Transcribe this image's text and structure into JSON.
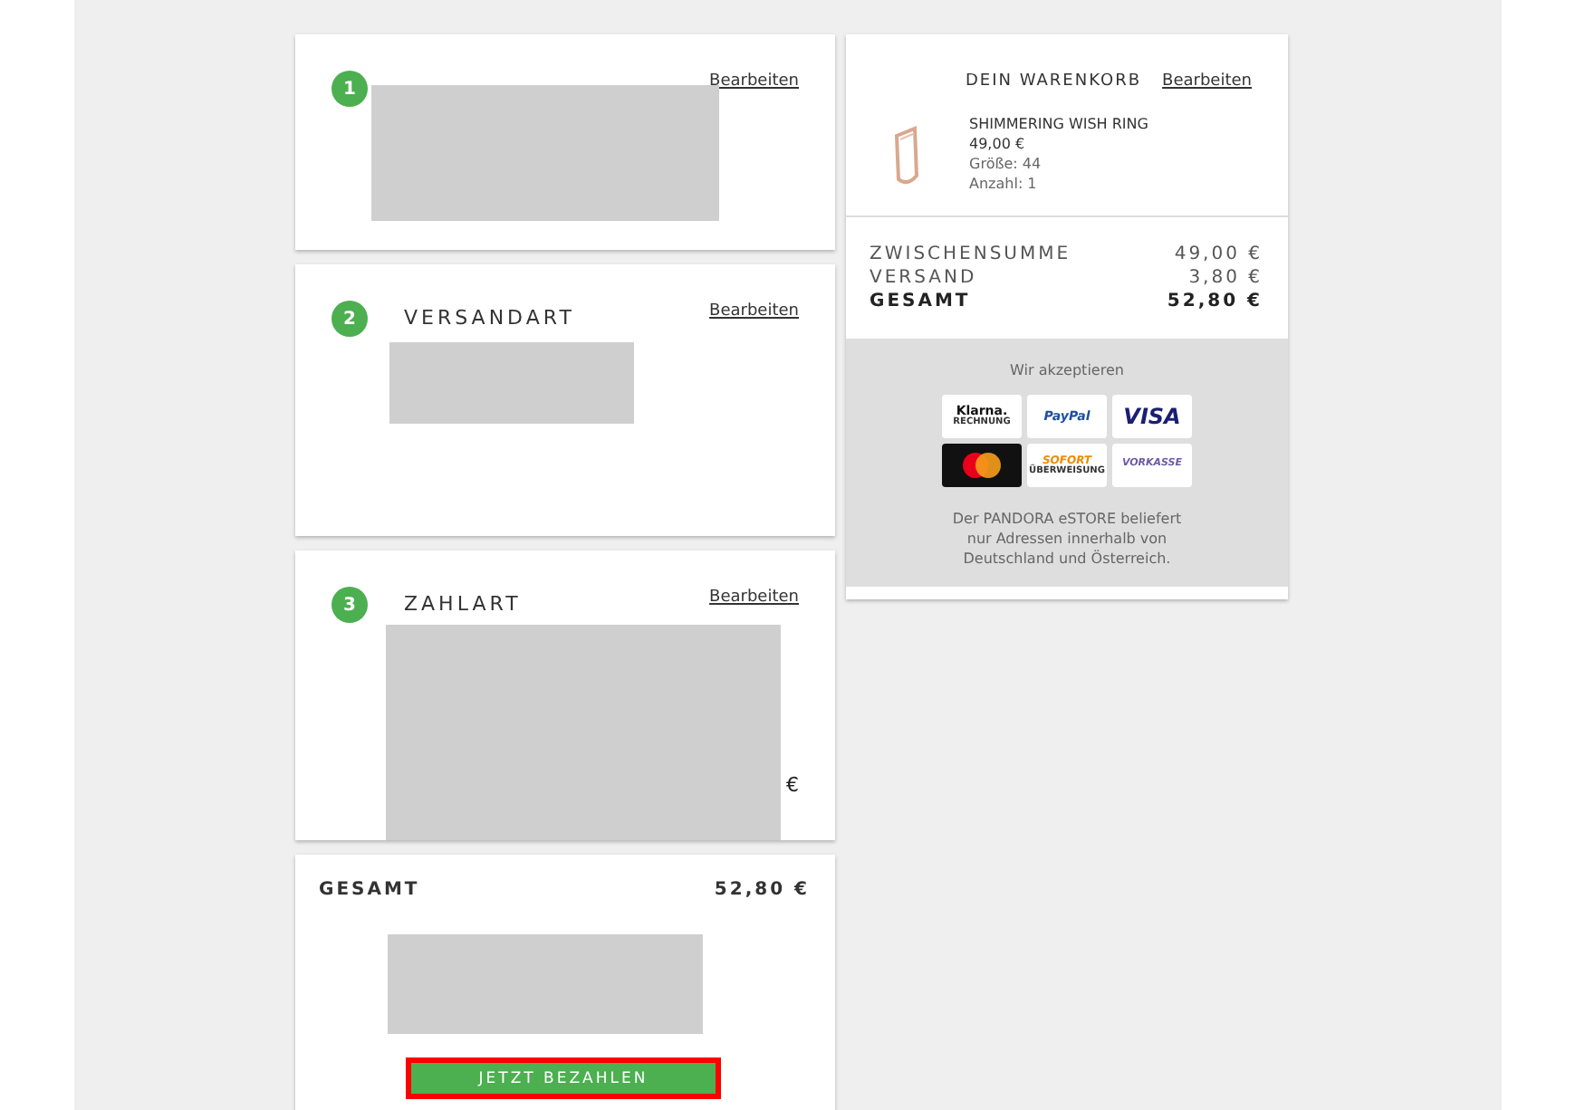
{
  "steps": [
    {
      "number": "1",
      "edit_link": "Bearbeiten",
      "redacted": true
    },
    {
      "number": "2",
      "title": "VERSANDART",
      "edit_link": "Bearbeiten",
      "redacted": true
    },
    {
      "number": "3",
      "title": "ZAHLART",
      "edit_link": "Bearbeiten",
      "redacted": true,
      "trailing": "€"
    }
  ],
  "order_total": {
    "label": "GESAMT",
    "value": "52,80 €",
    "redacted": true,
    "pay_button": {
      "label": "JETZT BEZAHLEN",
      "highlighted": true
    }
  },
  "cart": {
    "title": "DEIN WARENKORB",
    "edit_link": "Bearbeiten",
    "item": {
      "name": "SHIMMERING WISH RING",
      "price": "49,00 €",
      "size": "Größe: 44",
      "quantity": "Anzahl: 1"
    },
    "summary": [
      {
        "label": "ZWISCHENSUMME",
        "value": "49,00 €",
        "bold": false
      },
      {
        "label": "VERSAND",
        "value": "3,80 €",
        "bold": false
      },
      {
        "label": "GESAMT",
        "value": "52,80 €",
        "bold": true
      }
    ]
  },
  "payments": {
    "title": "Wir akzeptieren",
    "methods": [
      {
        "kind": "klarna",
        "label": "Klarna.",
        "sublabel": "RECHNUNG"
      },
      {
        "kind": "paypal",
        "label": "PayPal"
      },
      {
        "kind": "visa",
        "label": "VISA"
      },
      {
        "kind": "mastercard"
      },
      {
        "kind": "sofort",
        "label": "SOFORT",
        "sublabel": "ÜBERWEISUNG"
      },
      {
        "kind": "vorkasse",
        "label": "VORKASSE"
      }
    ],
    "note": "Der PANDORA eSTORE beliefert nur Adressen innerhalb von Deutschland und Österreich."
  }
}
